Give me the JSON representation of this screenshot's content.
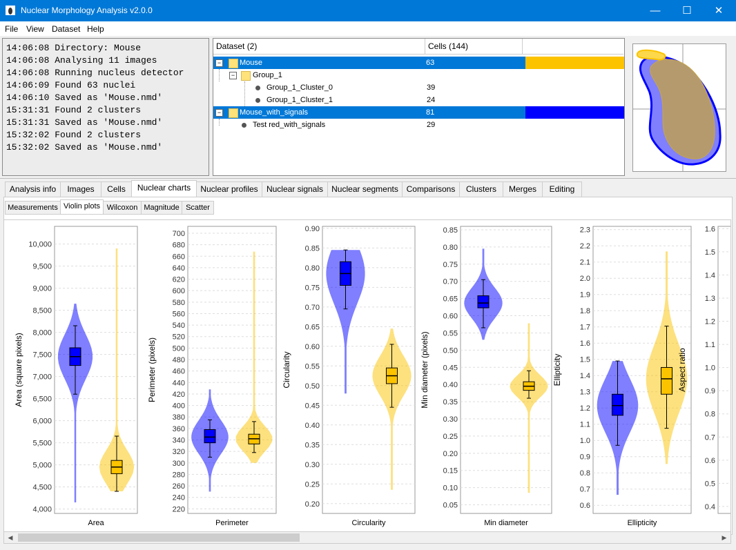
{
  "window": {
    "title": "Nuclear Morphology Analysis v2.0.0",
    "controls": {
      "minimize": "—",
      "maximize": "☐",
      "close": "✕"
    }
  },
  "menu": [
    "File",
    "View",
    "Dataset",
    "Help"
  ],
  "log": [
    "14:06:08 Directory: Mouse",
    "14:06:08 Analysing 11 images",
    "14:06:08 Running nucleus detector",
    "14:06:09 Found 63 nuclei",
    "14:06:10 Saved as 'Mouse.nmd'",
    "15:31:31 Found 2 clusters",
    "15:31:31 Saved as 'Mouse.nmd'",
    "15:32:02 Found 2 clusters",
    "15:32:02 Saved as 'Mouse.nmd'"
  ],
  "tree": {
    "headers": [
      "Dataset (2)",
      "Cells (144)"
    ],
    "rows": [
      {
        "label": "Mouse",
        "cells": "63",
        "selected": true,
        "color": "#fcc300",
        "toggle": "−"
      },
      {
        "label": "Group_1",
        "cells": "",
        "selected": false,
        "toggle": "−"
      },
      {
        "label": "Group_1_Cluster_0",
        "cells": "39",
        "selected": false
      },
      {
        "label": "Group_1_Cluster_1",
        "cells": "24",
        "selected": false
      },
      {
        "label": "Mouse_with_signals",
        "cells": "81",
        "selected": true,
        "color": "#0000ff",
        "toggle": "−"
      },
      {
        "label": "Test red_with_signals",
        "cells": "29",
        "selected": false
      }
    ]
  },
  "tabs": [
    "Analysis info",
    "Images",
    "Cells",
    "Nuclear charts",
    "Nuclear profiles",
    "Nuclear signals",
    "Nuclear segments",
    "Comparisons",
    "Clusters",
    "Merges",
    "Editing"
  ],
  "active_tab": "Nuclear charts",
  "subtabs": [
    "Measurements",
    "Violin plots",
    "Wilcoxon",
    "Magnitude",
    "Scatter"
  ],
  "active_subtab": "Violin plots",
  "colors": {
    "series1": "#0000ff",
    "series2": "#fcc300",
    "selection": "#0078d7"
  },
  "chart_data": [
    {
      "type": "violin",
      "xlabel": "Area",
      "ylabel": "Area (square pixels)",
      "yticks": [
        "10,000",
        "9,500",
        "9,000",
        "8,500",
        "8,000",
        "7,500",
        "7,000",
        "6,500",
        "6,000",
        "5,500",
        "5,000",
        "4,500",
        "4,000"
      ],
      "ylim": [
        3900,
        10400
      ],
      "series": [
        {
          "name": "Mouse",
          "color": "#0000ff",
          "min": 4150,
          "q1": 7250,
          "median": 7450,
          "q3": 7650,
          "max": 8650,
          "whisker_low": 6600,
          "whisker_high": 8150
        },
        {
          "name": "Mouse_with_signals",
          "color": "#fcc300",
          "min": 4400,
          "q1": 4800,
          "median": 4950,
          "q3": 5100,
          "max": 9900,
          "whisker_low": 4400,
          "whisker_high": 5650
        }
      ]
    },
    {
      "type": "violin",
      "xlabel": "Perimeter",
      "ylabel": "Perimeter (pixels)",
      "yticks": [
        "700",
        "680",
        "660",
        "640",
        "620",
        "600",
        "580",
        "560",
        "540",
        "520",
        "500",
        "480",
        "460",
        "440",
        "420",
        "400",
        "380",
        "360",
        "340",
        "320",
        "300",
        "280",
        "260",
        "240",
        "220"
      ],
      "ylim": [
        212,
        712
      ],
      "series": [
        {
          "name": "Mouse",
          "color": "#0000ff",
          "min": 250,
          "q1": 335,
          "median": 345,
          "q3": 358,
          "max": 428,
          "whisker_low": 310,
          "whisker_high": 375
        },
        {
          "name": "Mouse_with_signals",
          "color": "#fcc300",
          "min": 300,
          "q1": 333,
          "median": 342,
          "q3": 350,
          "max": 668,
          "whisker_low": 318,
          "whisker_high": 372
        }
      ]
    },
    {
      "type": "violin",
      "xlabel": "Circularity",
      "ylabel": "Circularity",
      "yticks": [
        "0.90",
        "0.85",
        "0.80",
        "0.75",
        "0.70",
        "0.65",
        "0.60",
        "0.55",
        "0.50",
        "0.45",
        "0.40",
        "0.35",
        "0.30",
        "0.25",
        "0.20"
      ],
      "ylim": [
        0.175,
        0.905
      ],
      "series": [
        {
          "name": "Mouse",
          "color": "#0000ff",
          "min": 0.48,
          "q1": 0.755,
          "median": 0.785,
          "q3": 0.815,
          "max": 0.845,
          "whisker_low": 0.695,
          "whisker_high": 0.845
        },
        {
          "name": "Mouse_with_signals",
          "color": "#fcc300",
          "min": 0.235,
          "q1": 0.505,
          "median": 0.525,
          "q3": 0.545,
          "max": 0.645,
          "whisker_low": 0.445,
          "whisker_high": 0.605
        }
      ]
    },
    {
      "type": "violin",
      "xlabel": "Min diameter",
      "ylabel": "Min diameter (pixels)",
      "yticks": [
        "0.85",
        "0.80",
        "0.75",
        "0.70",
        "0.65",
        "0.60",
        "0.55",
        "0.50",
        "0.45",
        "0.40",
        "0.35",
        "0.30",
        "0.25",
        "0.20",
        "0.15",
        "0.10",
        "0.05"
      ],
      "ylim": [
        0.025,
        0.86
      ],
      "series": [
        {
          "name": "Mouse",
          "color": "#0000ff",
          "min": 0.53,
          "q1": 0.623,
          "median": 0.637,
          "q3": 0.658,
          "max": 0.795,
          "whisker_low": 0.565,
          "whisker_high": 0.705
        },
        {
          "name": "Mouse_with_signals",
          "color": "#fcc300",
          "min": 0.085,
          "q1": 0.383,
          "median": 0.395,
          "q3": 0.408,
          "max": 0.578,
          "whisker_low": 0.36,
          "whisker_high": 0.44
        }
      ]
    },
    {
      "type": "violin",
      "xlabel": "Ellipticity",
      "ylabel": "Ellipticity",
      "yticks": [
        "2.3",
        "2.2",
        "2.1",
        "2.0",
        "1.9",
        "1.8",
        "1.7",
        "1.6",
        "1.5",
        "1.4",
        "1.3",
        "1.2",
        "1.1",
        "1.0",
        "0.9",
        "0.8",
        "0.7",
        "0.6"
      ],
      "ylim": [
        0.55,
        2.32
      ],
      "series": [
        {
          "name": "Mouse",
          "color": "#0000ff",
          "min": 0.665,
          "q1": 1.155,
          "median": 1.215,
          "q3": 1.285,
          "max": 1.49,
          "whisker_low": 0.97,
          "whisker_high": 1.49
        },
        {
          "name": "Mouse_with_signals",
          "color": "#fcc300",
          "min": 0.855,
          "q1": 1.285,
          "median": 1.38,
          "q3": 1.45,
          "max": 2.165,
          "whisker_low": 1.075,
          "whisker_high": 1.705
        }
      ]
    },
    {
      "type": "violin",
      "xlabel": "",
      "ylabel": "Aspect ratio",
      "yticks": [
        "1.6",
        "1.5",
        "1.4",
        "1.3",
        "1.2",
        "1.1",
        "1.0",
        "0.9",
        "0.8",
        "0.7",
        "0.6",
        "0.5",
        "0.4"
      ],
      "ylim": [
        0.37,
        1.61
      ],
      "series": []
    }
  ]
}
